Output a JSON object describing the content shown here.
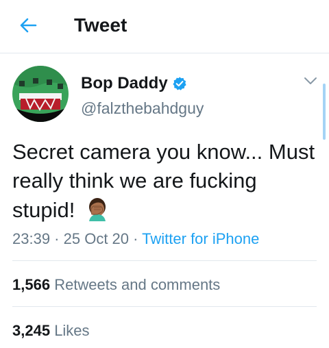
{
  "header": {
    "title": "Tweet",
    "back_icon": "arrow-left-icon"
  },
  "author": {
    "name": "Bop Daddy",
    "handle": "@falzthebahdguy",
    "verified_icon": "verified-badge-icon"
  },
  "tweet": {
    "text": "Secret camera you know... Must really think we are fucking stupid!",
    "emoji": "face-palm-emoji-icon"
  },
  "meta": {
    "time": "23:39",
    "sep1": " · ",
    "date": "25 Oct 20",
    "sep2": " · ",
    "source": "Twitter for iPhone"
  },
  "stats": {
    "retweets": {
      "count": "1,566",
      "label": "Retweets and comments"
    },
    "likes": {
      "count": "3,245",
      "label": "Likes"
    }
  },
  "colors": {
    "accent": "#1da1f2",
    "muted": "#657786",
    "text": "#14171a",
    "border": "#e1e8ed"
  }
}
